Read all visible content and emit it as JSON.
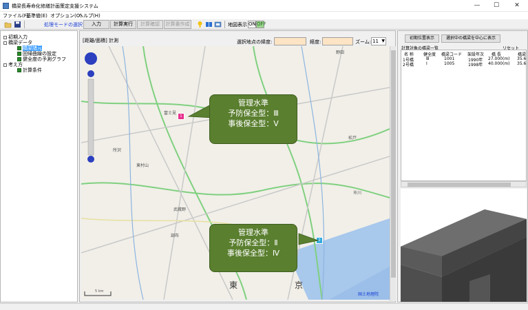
{
  "window": {
    "title": "橋梁長寿命化修繕計画策定支援システム",
    "minimize": "—",
    "maximize": "☐",
    "close": "✕"
  },
  "menu": {
    "items": [
      "ファイル(F)",
      "基準値(E)",
      "オプション(O)",
      "ヘルプ(H)"
    ]
  },
  "toolbar": {
    "mode_label": "処理モードの選択",
    "input": "入力",
    "calc_run": "計算実行",
    "calc_check": "計算確認",
    "calc_doc": "計算書作成",
    "map_display": "地図表示",
    "on": "ON",
    "off": "OFF"
  },
  "tree": {
    "items": [
      {
        "label": "初期入力",
        "level": 0
      },
      {
        "label": "橋梁データ",
        "level": 0
      },
      {
        "label": "橋梁諸元",
        "level": 1,
        "selected": true
      },
      {
        "label": "回帰曲線の設定",
        "level": 1
      },
      {
        "label": "健全度の予測グラフ",
        "level": 1
      },
      {
        "label": "考え方",
        "level": 0
      },
      {
        "label": "計算条件",
        "level": 1
      }
    ]
  },
  "map": {
    "tab": "[距離/面積] 計測",
    "lat_label": "選択地点の緯度:",
    "lon_label": "経度:",
    "zoom_label": "ズーム:",
    "zoom_value": "11",
    "scale": "5 km",
    "credit": "国土地理院",
    "place_names": [
      "富士見",
      "所沢",
      "東村山",
      "武蔵野",
      "調布",
      "野田",
      "松戸",
      "市川",
      "東",
      "京"
    ],
    "callouts": [
      {
        "title": "管理水準",
        "line1": "予防保全型：Ⅲ",
        "line2": "事後保全型：Ⅴ"
      },
      {
        "title": "管理水準",
        "line1": "予防保全型：Ⅱ",
        "line2": "事後保全型：Ⅳ"
      }
    ],
    "markers": [
      {
        "label": "1",
        "color": "#e8308c"
      },
      {
        "label": "2",
        "color": "#33aadd"
      }
    ]
  },
  "right": {
    "btn_initial": "初期位置表示",
    "btn_center": "選択中の橋梁を中心に表示",
    "list_title": "計算対象の橋梁一覧",
    "reset": "リセット",
    "columns": [
      "名 称",
      "健全度",
      "橋梁コード",
      "架設年次",
      "橋 長",
      "橋梁"
    ],
    "rows": [
      [
        "1号橋",
        "Ⅲ",
        "1001",
        "1990年",
        "27.000(m)",
        "35.6"
      ],
      [
        "2号橋",
        "Ⅰ",
        "1005",
        "1998年",
        "40.000(m)",
        "35.6"
      ]
    ]
  }
}
